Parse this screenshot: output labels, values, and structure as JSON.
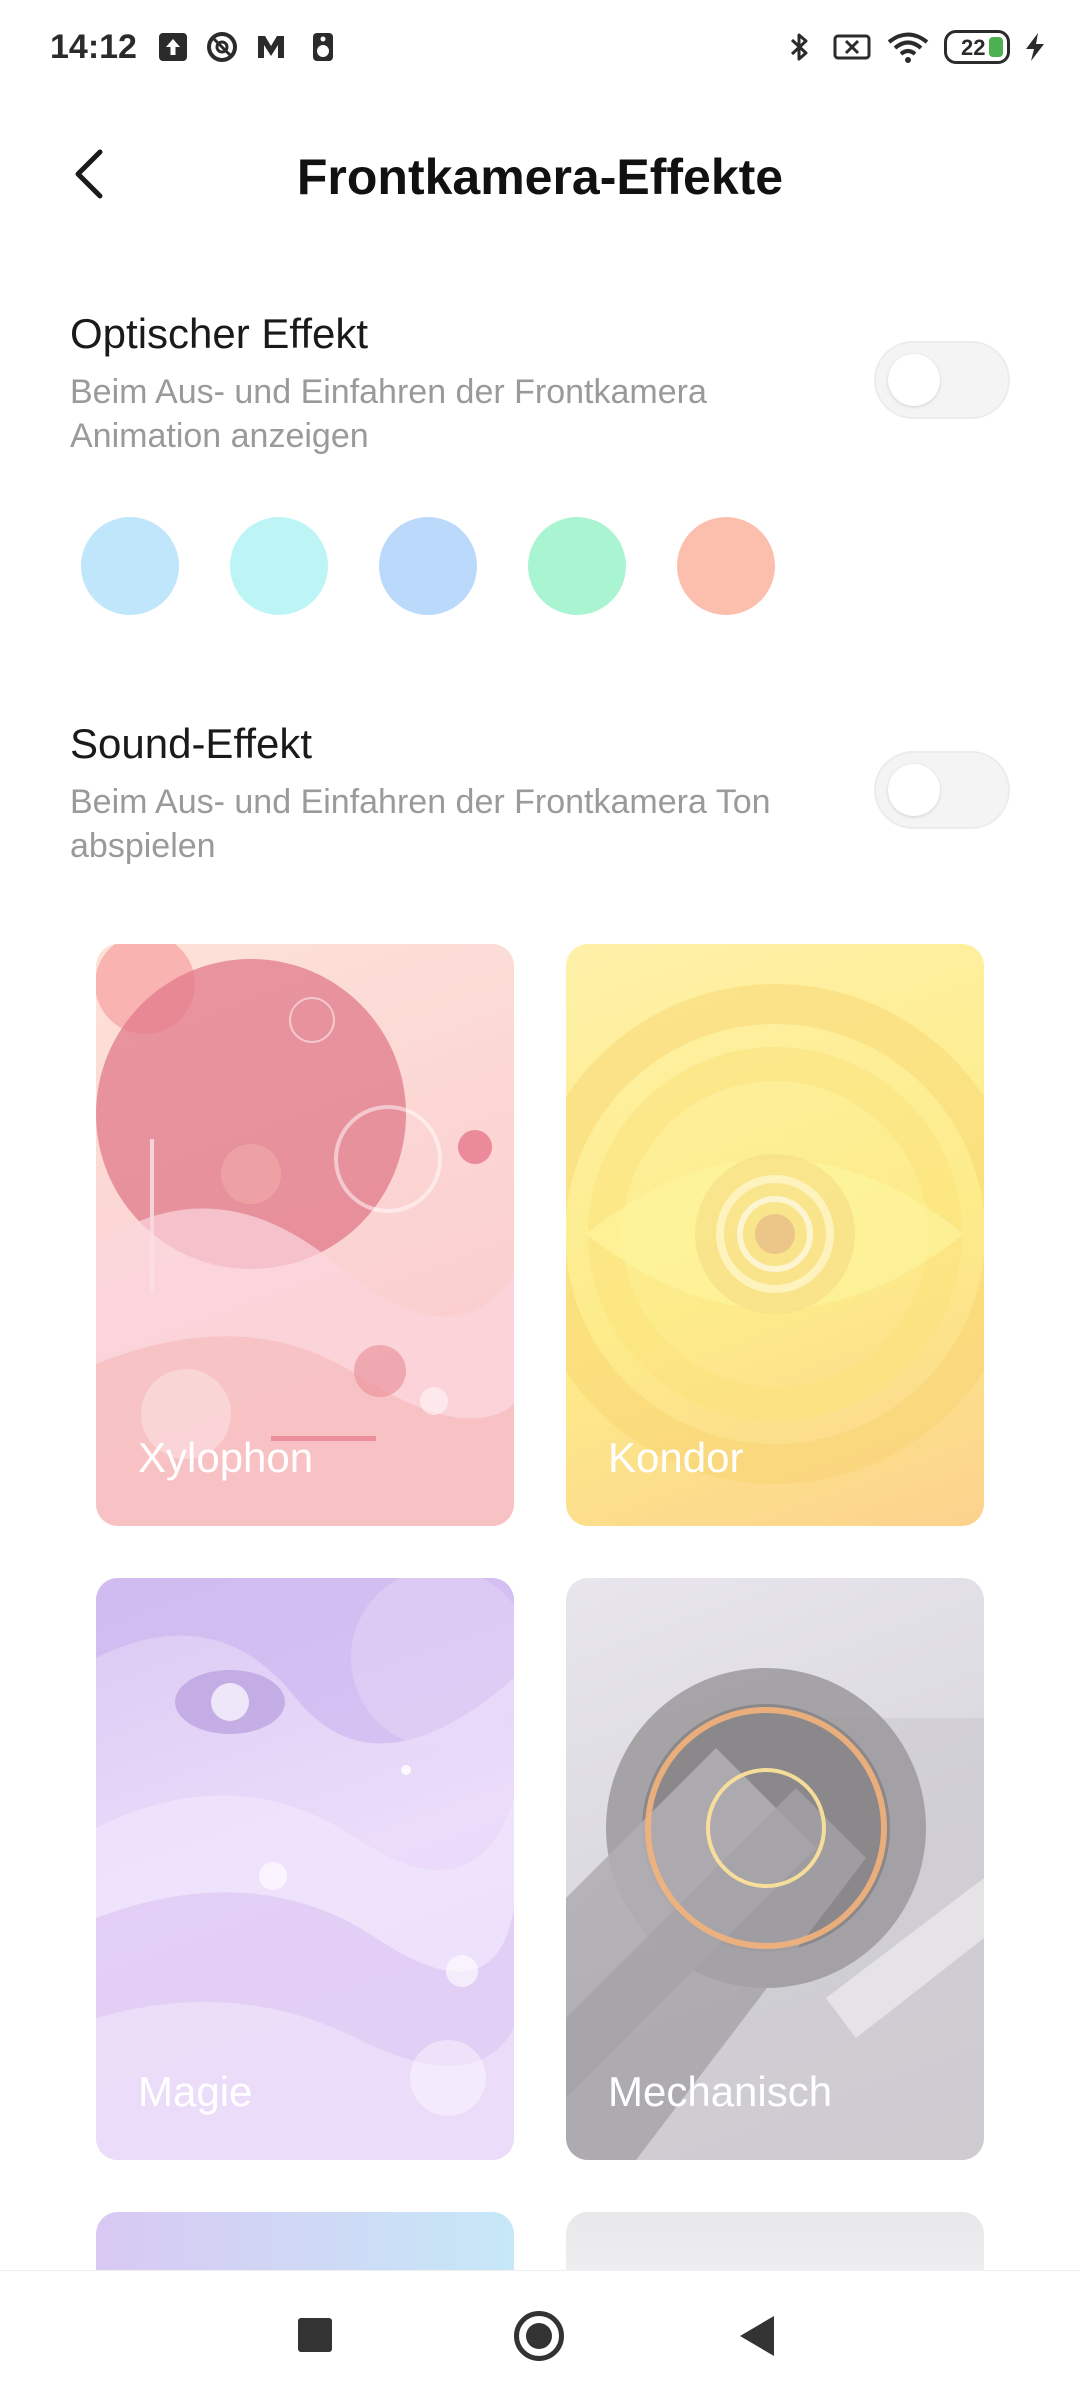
{
  "status_bar": {
    "time": "14:12",
    "battery_level": "22",
    "icons": [
      "upload-icon",
      "sync-icon",
      "mail-icon",
      "speaker-icon",
      "bluetooth-icon",
      "sim-off-icon",
      "wifi-icon",
      "battery-icon",
      "charging-icon"
    ]
  },
  "header": {
    "title": "Frontkamera-Effekte",
    "back_icon": "back-arrow-icon"
  },
  "optical_effect": {
    "title": "Optischer Effekt",
    "description": "Beim Aus- und Einfahren der Frontkamera Animation anzeigen",
    "enabled": false,
    "colors": [
      "#bfe6fb",
      "#bdf5f7",
      "#bbd9fb",
      "#a9f4d1",
      "#fcbfae"
    ]
  },
  "sound_effect": {
    "title": "Sound-Effekt",
    "description": "Beim Aus- und Einfahren der Frontkamera Ton abspielen",
    "enabled": false
  },
  "sound_cards": [
    {
      "label": "Xylophon"
    },
    {
      "label": "Kondor"
    },
    {
      "label": "Magie"
    },
    {
      "label": "Mechanisch"
    }
  ],
  "nav_bar": {
    "icons": [
      "recents-square-icon",
      "home-circle-icon",
      "back-triangle-icon"
    ]
  }
}
